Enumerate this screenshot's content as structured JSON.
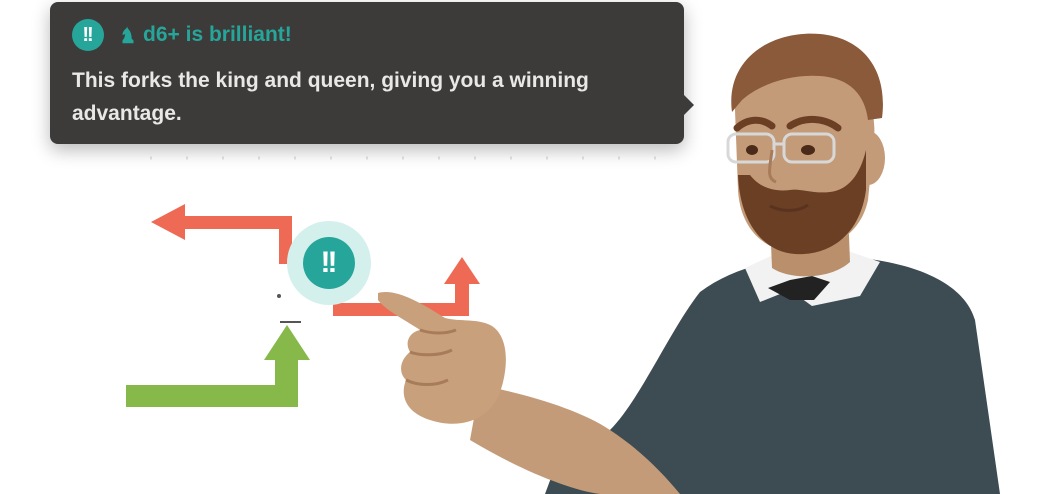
{
  "tooltip": {
    "badge": "!!",
    "piece_icon": "knight-icon",
    "headline": "d6+ is brilliant!",
    "body": "This forks the king and queen, giving you a winning advantage."
  },
  "move_badge": {
    "label": "!!"
  },
  "colors": {
    "tooltip_bg": "#3d3b39",
    "brilliant": "#26a69a",
    "brilliant_halo": "#d4f0ed",
    "arrow_red": "#ee6a55",
    "arrow_green": "#86b84a",
    "sweater": "#3d4c53",
    "skin": "#c39b78",
    "hair": "#8a5a3a",
    "beard": "#6b3f24"
  }
}
